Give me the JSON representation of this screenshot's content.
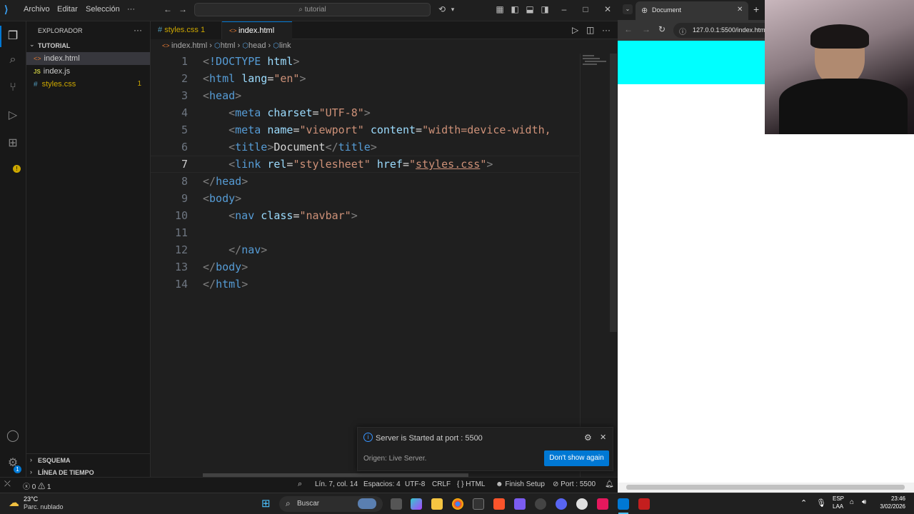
{
  "titlebar": {
    "menus": [
      "Archivo",
      "Editar",
      "Selección",
      "···"
    ],
    "search_placeholder": "tutorial"
  },
  "sidebar": {
    "header": "EXPLORADOR",
    "folder": "TUTORIAL",
    "files": [
      {
        "name": "index.html",
        "icon": "<>",
        "color": "#e37933",
        "selected": true,
        "badge": ""
      },
      {
        "name": "index.js",
        "icon": "JS",
        "color": "#cbcb41",
        "selected": false,
        "badge": ""
      },
      {
        "name": "styles.css",
        "icon": "#",
        "color": "#519aba",
        "selected": false,
        "badge": "1"
      }
    ],
    "outline": "ESQUEMA",
    "timeline": "LÍNEA DE TIEMPO"
  },
  "tabs": [
    {
      "label": "styles.css",
      "badge": "1",
      "icon": "#"
    },
    {
      "label": "index.html",
      "icon": "<>"
    }
  ],
  "breadcrumb": [
    "index.html",
    "html",
    "head",
    "link"
  ],
  "line_numbers": [
    "1",
    "2",
    "3",
    "4",
    "5",
    "6",
    "7",
    "8",
    "9",
    "10",
    "11",
    "12",
    "13",
    "14"
  ],
  "notification": {
    "message": "Server is Started at port : 5500",
    "source": "Origen: Live Server.",
    "button": "Don't show again"
  },
  "statusbar": {
    "errors": "0",
    "warnings": "1",
    "position": "Lín. 7, col. 14",
    "spaces": "Espacios: 4",
    "encoding": "UTF-8",
    "eol": "CRLF",
    "language": "HTML",
    "finish_setup": "Finish Setup",
    "port": "Port : 5500"
  },
  "browser": {
    "tab_title": "Document",
    "url": "127.0.0.1:5500/index.html",
    "nav_color": "#00ffff"
  },
  "taskbar": {
    "weather_temp": "23°C",
    "weather_desc": "Parc. nublado",
    "search": "Buscar",
    "lang1": "ESP",
    "lang2": "LAA",
    "time": "23:46",
    "date": "3/02/2026"
  }
}
